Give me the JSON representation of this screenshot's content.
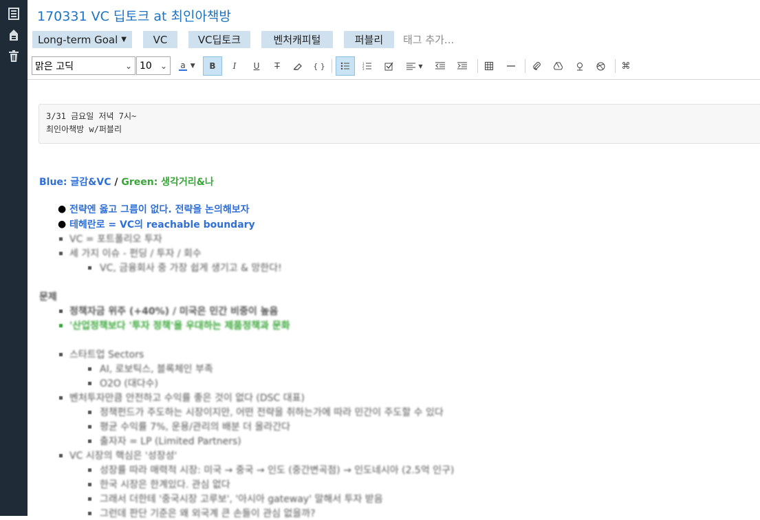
{
  "note": {
    "title": "170331 VC 딥토크 at 최인아책방"
  },
  "tags": {
    "notebook": "Long-term Goal",
    "items": [
      "VC",
      "VC딥토크",
      "벤처캐피털",
      "퍼블리"
    ],
    "add_placeholder": "태그 추가..."
  },
  "toolbar": {
    "font_family": "맑은 고딕",
    "font_size": "10",
    "text_color_label": "a"
  },
  "body": {
    "code_line1": "3/31 금요일 저녁 7시~",
    "code_line2": "최인아책방 w/퍼블리",
    "legend_blue": "Blue: 글감&VC",
    "legend_sep": " / ",
    "legend_green": "Green: 생각거리&나",
    "bullets": [
      "전략엔 옳고 그름이 없다. 전략을 논의해보자",
      "테헤란로 = VC의 reachable boundary",
      "VC = 포트폴리오 투자",
      "세 가지 이슈 - 펀딩 / 투자 / 회수",
      "VC, 금융회사 중 가장 쉽게 생기고 & 망한다!",
      "문제",
      "정책자금 위주 (+40%) / 미국은 민간 비중이 높음",
      "'산업정책보다 '투자 정책'을 우대하는 제품정책과 문화",
      "스타트업 Sectors",
      "AI, 로보틱스, 블록체인 부족",
      "O2O (대다수)",
      "벤처투자만큼 안전하고 수익률 좋은 것이 없다 (DSC 대표)",
      "정책펀드가 주도하는 시장이지만, 어떤 전략을 취하는가에 따라 민간이 주도할 수 있다",
      "평균 수익률 7%, 운용/관리의 배분 더 올라간다",
      "출자자 = LP (Limited Partners)",
      "VC 시장의 핵심은 '성장성'",
      "성장률 따라 매력적 시장: 미국 → 중국 → 인도 (중간변곡점) → 인도네시아 (2.5억 인구)",
      "한국 시장은 한계있다. 관심 없다",
      "그래서 더한테 '중국시장 고루보', '아시아 gateway' 말해서 투자 받음",
      "그런데 판단 기준은 왜 외국계 큰 손들이 관심 없을까?"
    ]
  }
}
